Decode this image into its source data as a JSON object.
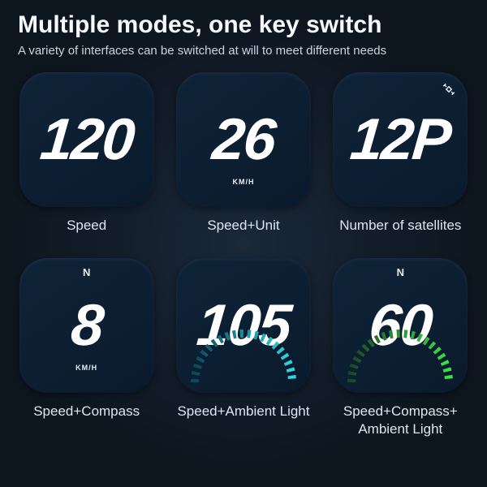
{
  "title": "Multiple modes, one key switch",
  "subtitle": "A variety of interfaces can be switched at will to meet different needs",
  "cards": [
    {
      "value": "120",
      "label": "Speed"
    },
    {
      "value": "26",
      "label": "Speed+Unit",
      "unit": "KM/H"
    },
    {
      "value": "12P",
      "label": "Number of satellites",
      "satellite": true
    },
    {
      "value": "8",
      "label": "Speed+Compass",
      "unit": "KM/H",
      "compass": "N"
    },
    {
      "value": "105",
      "label": "Speed+Ambient Light",
      "arc": "teal"
    },
    {
      "value": "60",
      "label": "Speed+Compass+\nAmbient Light",
      "compass": "N",
      "arc": "green"
    }
  ]
}
